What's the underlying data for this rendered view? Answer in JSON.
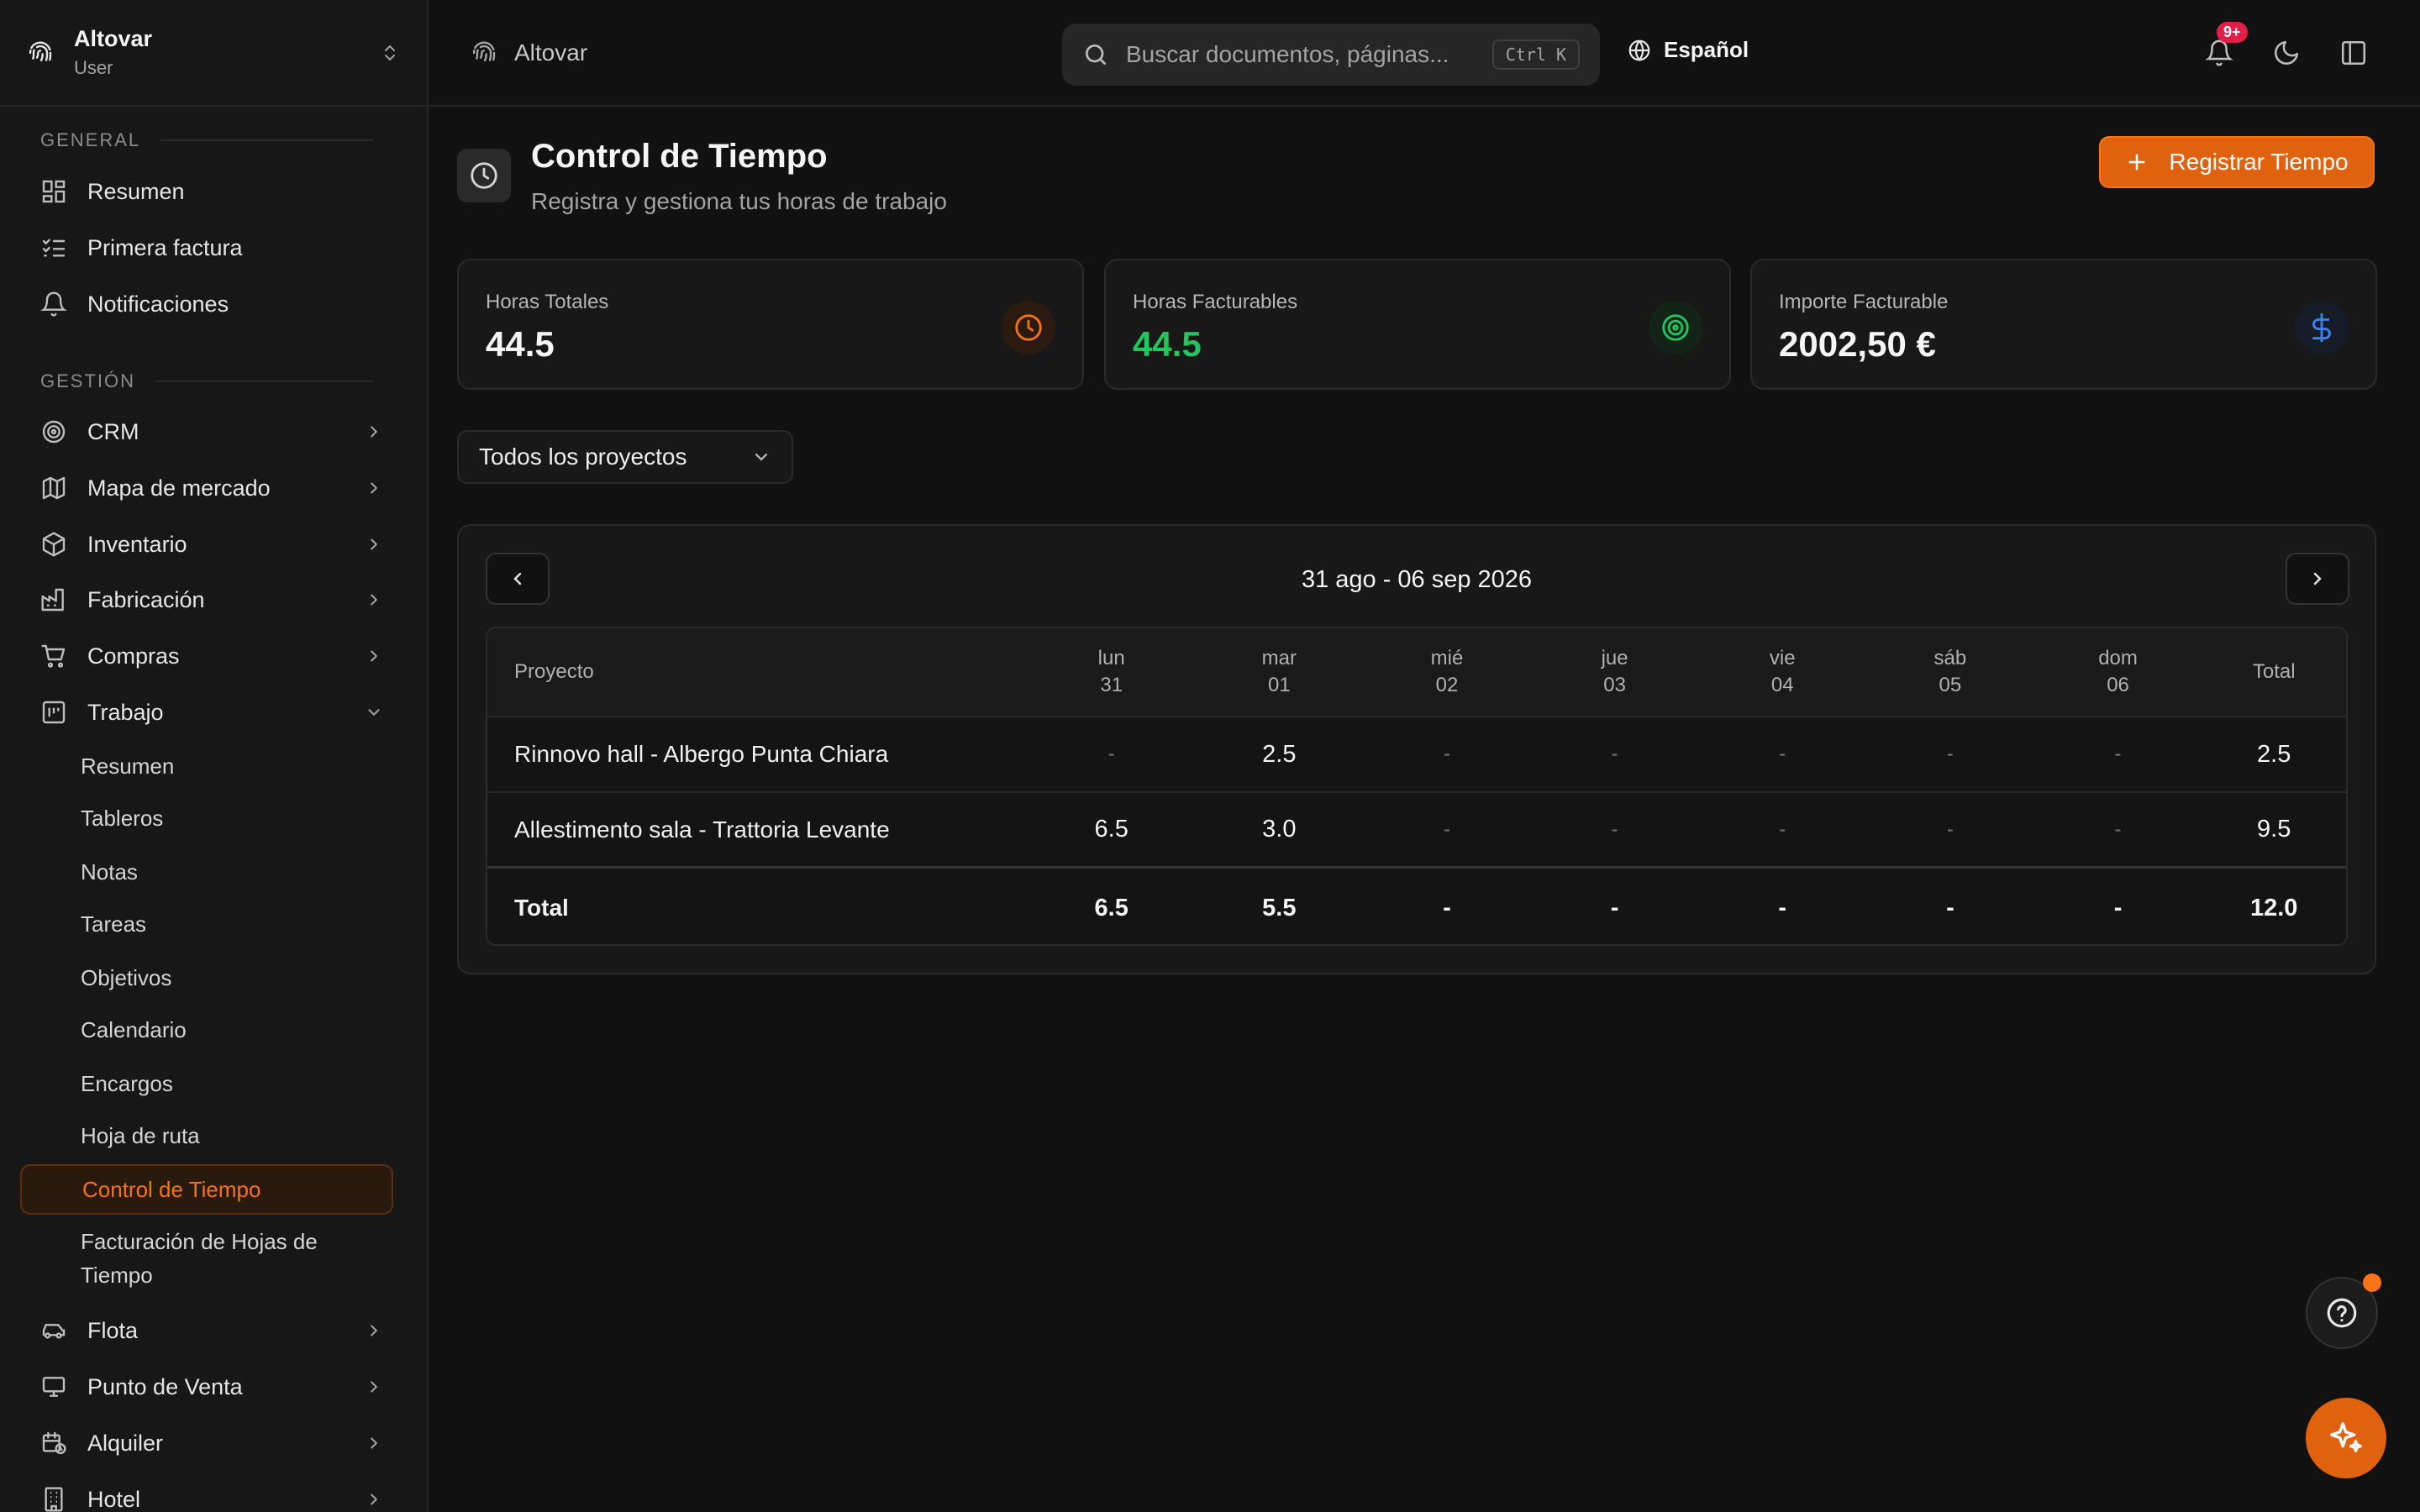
{
  "org": {
    "name": "Altovar",
    "role": "User"
  },
  "breadcrumb": {
    "label": "Altovar"
  },
  "search": {
    "placeholder": "Buscar documentos, páginas...",
    "shortcut": "Ctrl K"
  },
  "language": "Español",
  "notifications": {
    "badge": "9+"
  },
  "sidebar": {
    "sections": {
      "general": "GENERAL",
      "gestion": "GESTIÓN"
    },
    "general_items": [
      {
        "label": "Resumen",
        "icon": "dashboard-icon"
      },
      {
        "label": "Primera factura",
        "icon": "checklist-icon"
      },
      {
        "label": "Notificaciones",
        "icon": "bell-icon"
      }
    ],
    "gestion_items": [
      {
        "label": "CRM",
        "icon": "target-icon"
      },
      {
        "label": "Mapa de mercado",
        "icon": "map-icon"
      },
      {
        "label": "Inventario",
        "icon": "package-icon"
      },
      {
        "label": "Fabricación",
        "icon": "factory-icon"
      },
      {
        "label": "Compras",
        "icon": "cart-icon"
      },
      {
        "label": "Trabajo",
        "icon": "work-icon"
      }
    ],
    "trabajo_sub": [
      "Resumen",
      "Tableros",
      "Notas",
      "Tareas",
      "Objetivos",
      "Calendario",
      "Encargos",
      "Hoja de ruta",
      "Control de Tiempo",
      "Facturación de Hojas de Tiempo"
    ],
    "bottom_items": [
      {
        "label": "Flota",
        "icon": "car-icon"
      },
      {
        "label": "Punto de Venta",
        "icon": "monitor-icon"
      },
      {
        "label": "Alquiler",
        "icon": "calendar-clock-icon"
      },
      {
        "label": "Hotel",
        "icon": "building-icon"
      }
    ]
  },
  "page": {
    "title": "Control de Tiempo",
    "subtitle": "Registra y gestiona tus horas de trabajo",
    "primary_action": "Registrar Tiempo"
  },
  "stats": [
    {
      "label": "Horas Totales",
      "value": "44.5",
      "icon": "clock-icon",
      "color": "#f97316"
    },
    {
      "label": "Horas Facturables",
      "value": "44.5",
      "icon": "target-icon",
      "color": "#22c55e"
    },
    {
      "label": "Importe Facturable",
      "value": "2002,50 €",
      "icon": "dollar-icon",
      "color": "#3b82f6"
    }
  ],
  "filter": {
    "selected": "Todos los proyectos"
  },
  "week": {
    "range": "31 ago - 06 sep 2026"
  },
  "table": {
    "project_header": "Proyecto",
    "total_header": "Total",
    "days": [
      {
        "name": "lun",
        "num": "31"
      },
      {
        "name": "mar",
        "num": "01"
      },
      {
        "name": "mié",
        "num": "02"
      },
      {
        "name": "jue",
        "num": "03"
      },
      {
        "name": "vie",
        "num": "04"
      },
      {
        "name": "sáb",
        "num": "05"
      },
      {
        "name": "dom",
        "num": "06"
      }
    ],
    "rows": [
      {
        "project": "Rinnovo hall - Albergo Punta Chiara",
        "hours": [
          "-",
          "2.5",
          "-",
          "-",
          "-",
          "-",
          "-"
        ],
        "total": "2.5"
      },
      {
        "project": "Allestimento sala - Trattoria Levante",
        "hours": [
          "6.5",
          "3.0",
          "-",
          "-",
          "-",
          "-",
          "-"
        ],
        "total": "9.5"
      }
    ],
    "totals": {
      "label": "Total",
      "hours": [
        "6.5",
        "5.5",
        "-",
        "-",
        "-",
        "-",
        "-"
      ],
      "total": "12.0"
    }
  }
}
